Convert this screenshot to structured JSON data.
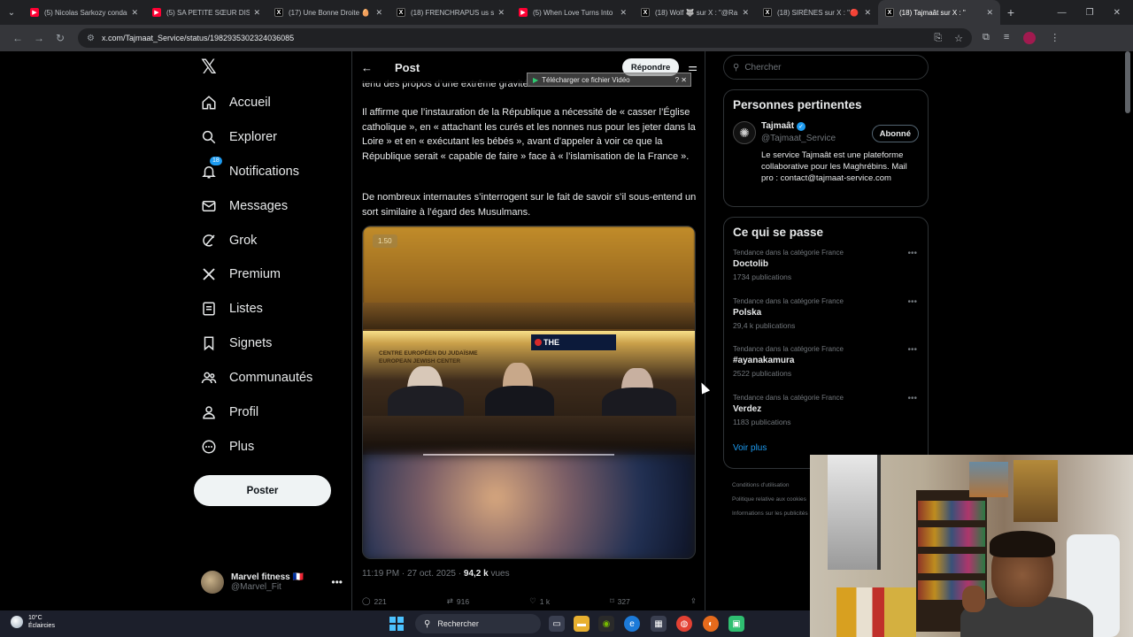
{
  "browser": {
    "tabs": [
      {
        "title": "(5) Nicolas Sarkozy condamné",
        "icon": "youtube",
        "active": false
      },
      {
        "title": "(5) SA PETITE SŒUR DISPARAÎT",
        "icon": "youtube",
        "active": false
      },
      {
        "title": "(17) Une Bonne Droite 🥚",
        "icon": "x",
        "active": false
      },
      {
        "title": "(18) FRENCHRAPUS us sur X",
        "icon": "x",
        "active": false
      },
      {
        "title": "(5) When Love Turns Into",
        "icon": "youtube",
        "active": false
      },
      {
        "title": "(18) Wolf 🐺 sur X : \"@Ra",
        "icon": "x",
        "active": false
      },
      {
        "title": "(18) SIRÈNES sur X : \"🔴",
        "icon": "x",
        "active": false
      },
      {
        "title": "(18) Tajmaât sur X : \"",
        "icon": "x",
        "active": true
      }
    ],
    "url": "x.com/Tajmaat_Service/status/1982935302324036085"
  },
  "nav": {
    "items": [
      {
        "label": "Accueil",
        "icon": "home-icon"
      },
      {
        "label": "Explorer",
        "icon": "search-icon"
      },
      {
        "label": "Notifications",
        "icon": "bell-icon",
        "badge": "18"
      },
      {
        "label": "Messages",
        "icon": "mail-icon"
      },
      {
        "label": "Grok",
        "icon": "grok-icon"
      },
      {
        "label": "Premium",
        "icon": "x-logo-icon"
      },
      {
        "label": "Listes",
        "icon": "list-icon"
      },
      {
        "label": "Signets",
        "icon": "bookmark-icon"
      },
      {
        "label": "Communautés",
        "icon": "people-icon"
      },
      {
        "label": "Profil",
        "icon": "person-icon"
      },
      {
        "label": "Plus",
        "icon": "more-circle-icon"
      }
    ],
    "post_button": "Poster",
    "account": {
      "name": "Marvel fitness 🇫🇷",
      "handle": "@Marvel_Fit"
    }
  },
  "post": {
    "header_title": "Post",
    "reply_button": "Répondre",
    "download_overlay": "Télécharger ce fichier Vidéo",
    "text_line0": "tenu des propos d’une extrême gravité.",
    "text_para1": "Il affirme que l’instauration de la République a nécessité de « casser l’Église catholique », en « attachant les curés et les nonnes nus pour les jeter dans la Loire » et en « exécutant les bébés », avant d’appeler à voir ce que la République serait « capable de faire » face à « l’islamisation de la France ».",
    "text_para2": "De nombreux internautes s’interrogent sur le fait de savoir s’il sous-entend un sort similaire à l’égard des Musulmans.",
    "video": {
      "speed_badge": "1.50",
      "sign_line1": "CENTRE EUROPÉEN DU JUDAÏSME",
      "sign_line2": "EUROPEAN JEWISH CENTER",
      "brand": "THE"
    },
    "time": "11:19 PM · 27 oct. 2025 · ",
    "views_value": "94,2 k",
    "views_label": " vues",
    "stats": {
      "replies": "221",
      "reposts": "916",
      "likes": "1 k",
      "bookmarks": "327"
    }
  },
  "right": {
    "search_placeholder": "Chercher",
    "relevant_title": "Personnes pertinentes",
    "person": {
      "name": "Tajmaât",
      "handle": "@Tajmaat_Service",
      "follow_label": "Abonné",
      "bio": "Le service Tajmaât est une plateforme collaborative pour les Maghrébins. Mail pro : contact@tajmaat-service.com"
    },
    "trends_title": "Ce qui se passe",
    "trends": [
      {
        "category": "Tendance dans la catégorie France",
        "name": "Doctolib",
        "count": "1734 publications"
      },
      {
        "category": "Tendance dans la catégorie France",
        "name": "Polska",
        "count": "29,4 k publications"
      },
      {
        "category": "Tendance dans la catégorie France",
        "name": "#ayanakamura",
        "count": "2522 publications"
      },
      {
        "category": "Tendance dans la catégorie France",
        "name": "Verdez",
        "count": "1183 publications"
      }
    ],
    "see_more": "Voir plus",
    "footer": [
      "Conditions d'utilisation",
      "Politique relative aux cookies",
      "Informations sur les publicités"
    ]
  },
  "taskbar": {
    "temperature": "10°C",
    "weather": "Éclaircies",
    "search_label": "Rechercher"
  }
}
